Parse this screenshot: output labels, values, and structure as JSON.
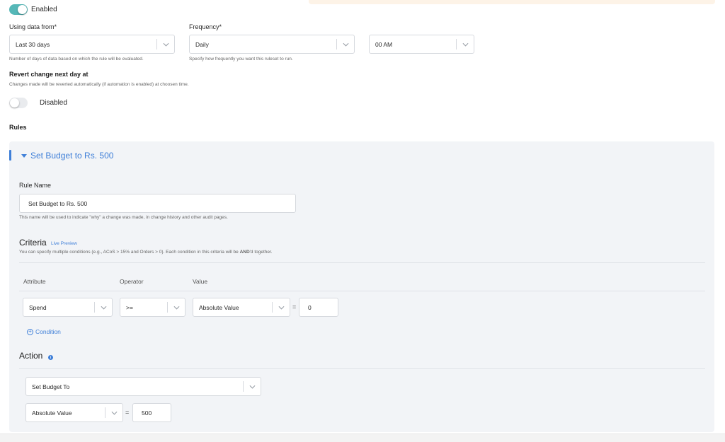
{
  "enabled_toggle": {
    "label": "Enabled",
    "state": "on"
  },
  "using_data": {
    "label": "Using data from*",
    "value": "Last 30 days",
    "help": "Number of days of data based on which the rule will be evaluated."
  },
  "frequency": {
    "label": "Frequency*",
    "value": "Daily",
    "help": "Specify how frequently you want this ruleset to run.",
    "time_value": "00 AM"
  },
  "revert": {
    "title": "Revert change next day at",
    "help": "Changes made will be reverted automatically (if automation is enabled) at choosen time.",
    "toggle_label": "Disabled",
    "state": "off"
  },
  "rules_title": "Rules",
  "rule": {
    "header": "Set Budget to Rs. 500",
    "name_label": "Rule Name",
    "name_value": "Set Budget to Rs. 500",
    "name_help": "This name will be used to indicate \"why\" a change was made, in change history and other audit pages.",
    "criteria": {
      "title": "Criteria",
      "live_preview": "Live Preview",
      "help_prefix": "You can specify multiple conditions (e.g., ACoS > 15% and Orders > 0). Each condition in this criteria will be ",
      "help_bold": "AND",
      "help_suffix": "'d together.",
      "columns": [
        "Attribute",
        "Operator",
        "Value"
      ],
      "condition": {
        "attribute": "Spend",
        "operator": ">=",
        "value_type": "Absolute Value",
        "equals": "=",
        "value": "0"
      },
      "add_condition": "Condition"
    },
    "action": {
      "title": "Action",
      "type": "Set Budget To",
      "value_type": "Absolute Value",
      "equals": "=",
      "value": "500"
    }
  },
  "colors": {
    "accent": "#3f7fd8",
    "toggle_on": "#56b8b8",
    "card_bg": "#f2f4f7"
  }
}
